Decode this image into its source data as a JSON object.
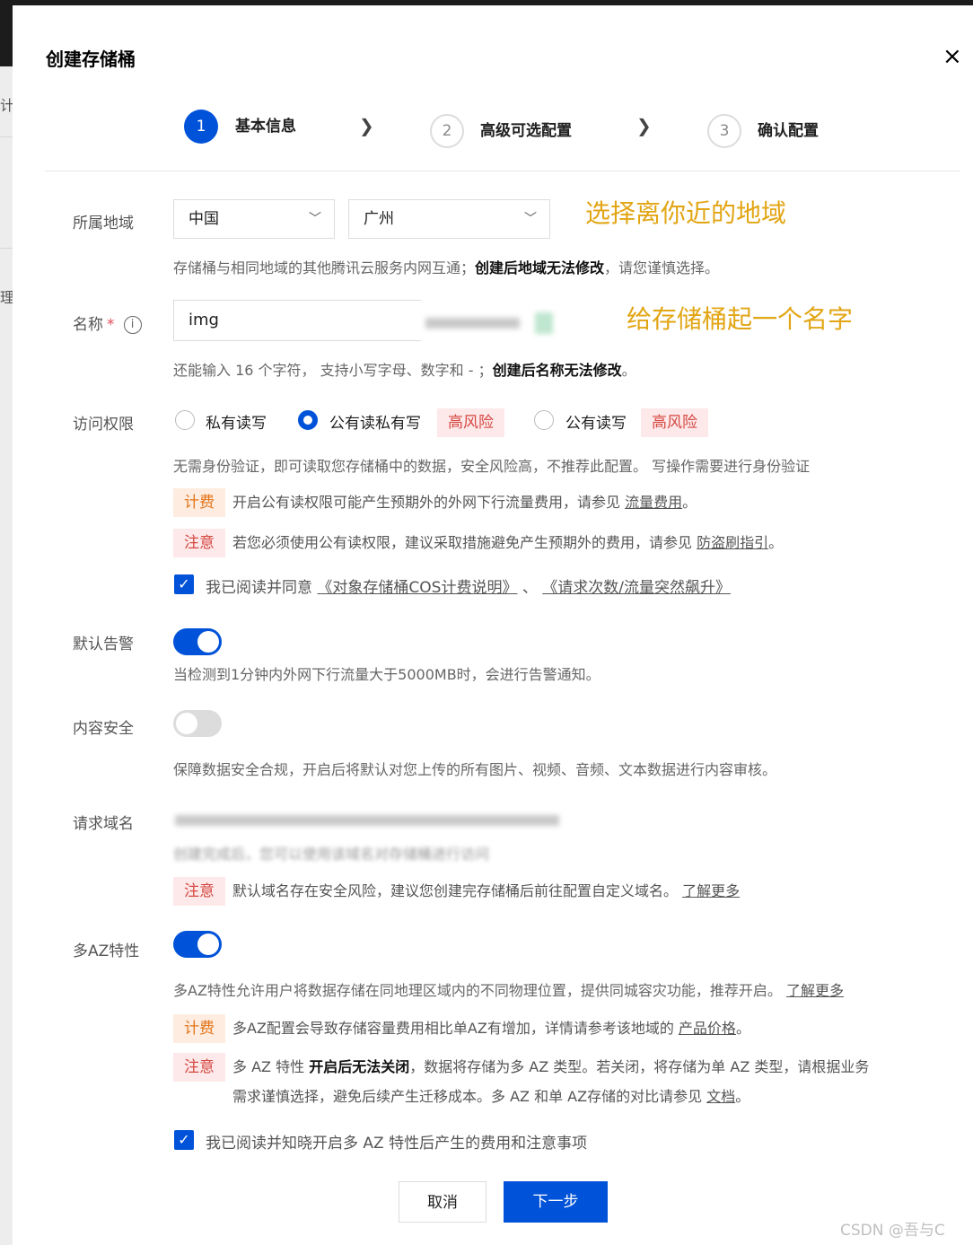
{
  "dialog": {
    "title": "创建存储桶",
    "close_glyph": "×",
    "side_text_top": "计",
    "side_text_mid": "理"
  },
  "steps": [
    {
      "number": "1",
      "label": "基本信息",
      "state": "active"
    },
    {
      "number": "2",
      "label": "高级可选配置",
      "state": "inactive"
    },
    {
      "number": "3",
      "label": "确认配置",
      "state": "inactive"
    }
  ],
  "region": {
    "label": "所属地域",
    "country": "中国",
    "city": "广州",
    "annotation": "选择离你近的地域",
    "help_prefix": "存储桶与相同地域的其他腾讯云服务内网互通；",
    "help_bold": "创建后地域无法修改",
    "help_suffix": "，请您谨慎选择。"
  },
  "name": {
    "label": "名称",
    "required_mark": "*",
    "info_glyph": "i",
    "value": "img",
    "annotation": "给存储桶起一个名字",
    "help_prefix": "还能输入 16 个字符， 支持小写字母、数字和 - ；",
    "help_bold": "创建后名称无法修改",
    "help_suffix": "。"
  },
  "access": {
    "label": "访问权限",
    "options": [
      {
        "label": "私有读写",
        "checked": false
      },
      {
        "label": "公有读私有写",
        "checked": true,
        "risk": "高风险"
      },
      {
        "label": "公有读写",
        "checked": false,
        "risk": "高风险"
      }
    ],
    "description": "无需身份验证，即可读取您存储桶中的数据，安全风险高，不推荐此配置。 写操作需要进行身份验证",
    "fee_tag": "计费",
    "fee_text": "开启公有读权限可能产生预期外的外网下行流量费用，请参见",
    "fee_link": "流量费用",
    "fee_end": "。",
    "note_tag": "注意",
    "note_text": "若您必须使用公有读权限，建议采取措施避免产生预期外的费用，请参见",
    "note_link": "防盗刷指引",
    "note_end": "。",
    "agree_prefix": "我已阅读并同意",
    "agree_link1": "《对象存储桶COS计费说明》",
    "agree_sep": "、",
    "agree_link2": "《请求次数/流量突然飙升》",
    "agree_checked": true
  },
  "alarm": {
    "label": "默认告警",
    "enabled": true,
    "help": "当检测到1分钟内外网下行流量大于5000MB时，会进行告警通知。"
  },
  "content_security": {
    "label": "内容安全",
    "enabled": false,
    "help": "保障数据安全合规，开启后将默认对您上传的所有图片、视频、音频、文本数据进行内容审核。"
  },
  "domain": {
    "label": "请求域名",
    "obscured_line2": "创建完成后，您可以使用该域名对存储桶进行访问",
    "note_tag": "注意",
    "note_text": "默认域名存在安全风险，建议您创建完存储桶后前往配置自定义域名。",
    "note_link": "了解更多"
  },
  "multi_az": {
    "label": "多AZ特性",
    "enabled": true,
    "help": "多AZ特性允许用户将数据存储在同地理区域内的不同物理位置，提供同城容灾功能，推荐开启。",
    "help_link": "了解更多",
    "fee_tag": "计费",
    "fee_text": "多AZ配置会导致存储容量费用相比单AZ有增加，详情请参考该地域的",
    "fee_link": "产品价格",
    "fee_end": "。",
    "note_tag": "注意",
    "note_prefix": "多 AZ 特性",
    "note_bold": "开启后无法关闭",
    "note_rest": "，数据将存储为多 AZ 类型。若关闭，将存储为单 AZ 类型，请根据业务",
    "note_line2": "需求谨慎选择，避免后续产生迁移成本。多 AZ 和单 AZ存储的对比请参见",
    "note_link": "文档",
    "note_end": "。",
    "agree_label": "我已阅读并知晓开启多 AZ 特性后产生的费用和注意事项",
    "agree_checked": true
  },
  "footer": {
    "cancel": "取消",
    "next": "下一步"
  },
  "watermark": "CSDN @吾与C",
  "colors": {
    "primary": "#0052d9",
    "annotation": "#e2a514",
    "risk": "#d54941",
    "fee": "#e37318"
  }
}
